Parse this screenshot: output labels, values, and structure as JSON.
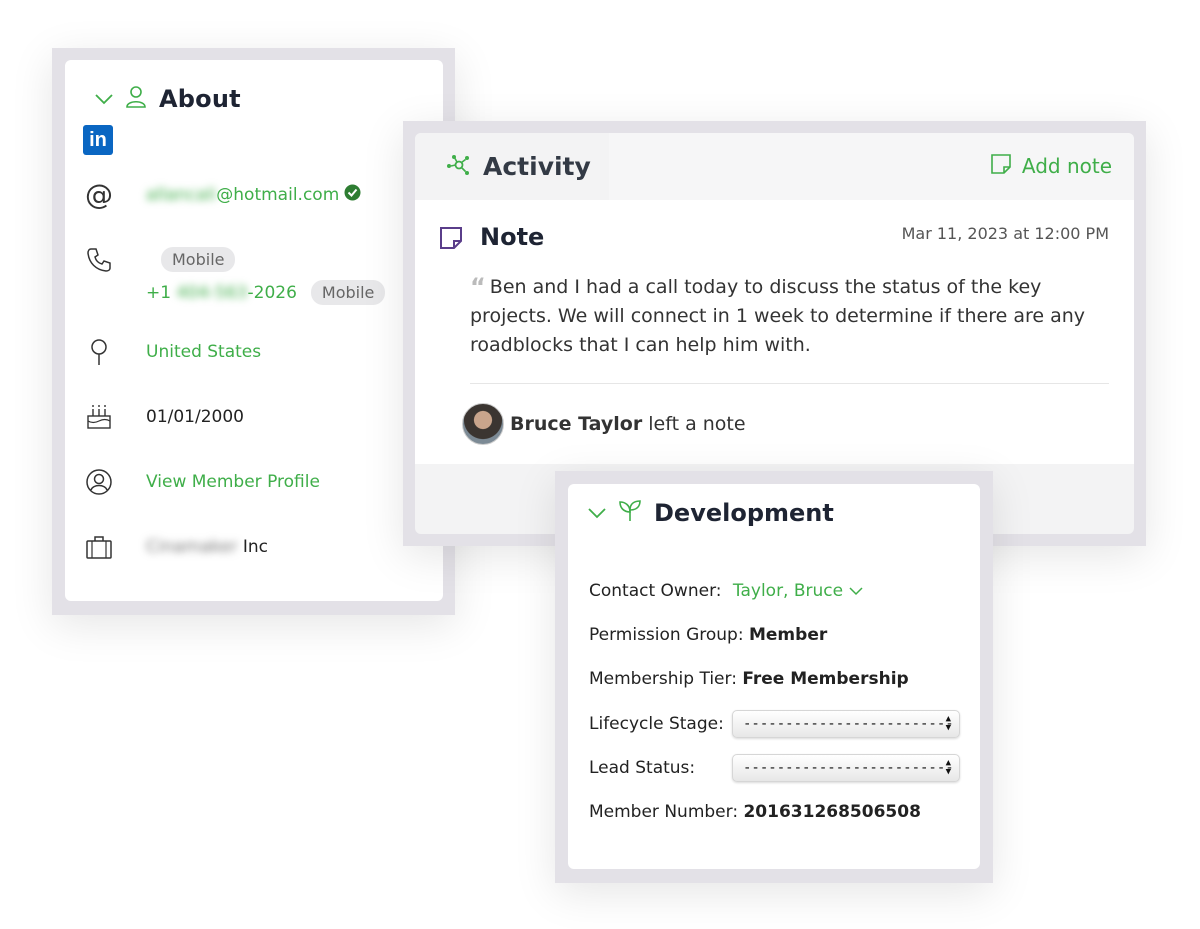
{
  "about": {
    "title": "About",
    "email_user": "allancali",
    "email_domain": "@hotmail.com",
    "phone_label_1": "Mobile",
    "phone_prefix": "+1",
    "phone_blur": "404-563",
    "phone_suffix": "-2026",
    "phone_label_2": "Mobile",
    "country": "United States",
    "birthday": "01/01/2000",
    "profile_link": "View Member Profile",
    "company_blur": "Cinamaker",
    "company_suffix": "Inc"
  },
  "activity": {
    "title": "Activity",
    "add_note": "Add note",
    "note_title": "Note",
    "note_date": "Mar 11, 2023 at 12:00 PM",
    "quote_mark": "“",
    "note_text": "Ben and I had a call today to discuss the status of the key projects. We will connect in 1 week to determine if there are any roadblocks that I can help him with.",
    "author_name": "Bruce Taylor",
    "author_action": "left a note"
  },
  "development": {
    "title": "Development",
    "contact_owner_label": "Contact Owner:",
    "contact_owner_value": "Taylor, Bruce",
    "permission_group_label": "Permission Group:",
    "permission_group_value": "Member",
    "membership_tier_label": "Membership Tier:",
    "membership_tier_value": "Free Membership",
    "lifecycle_stage_label": "Lifecycle Stage:",
    "lifecycle_stage_value": "--------------------------------",
    "lead_status_label": "Lead Status:",
    "lead_status_value": "--------------------------------",
    "member_number_label": "Member Number:",
    "member_number_value": "201631268506508"
  },
  "colors": {
    "accent_green": "#3fae49",
    "frame_gray": "#e3e1e7",
    "linkedin_blue": "#0a66c2",
    "note_purple": "#5a3d8a"
  },
  "icons": {
    "linkedin": "in"
  }
}
